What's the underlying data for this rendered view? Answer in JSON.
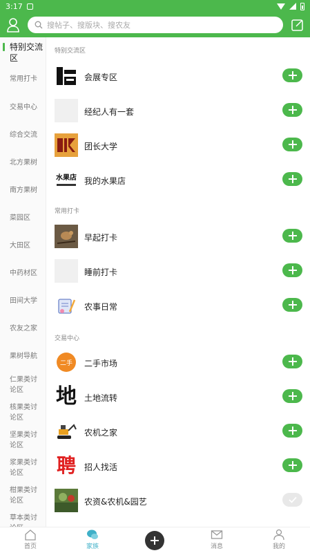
{
  "status": {
    "time": "3:17"
  },
  "search": {
    "placeholder": "搜帖子、搜版块、搜农友"
  },
  "sidebar": {
    "items": [
      {
        "label": "特别交流区",
        "active": true
      },
      {
        "label": "常用打卡"
      },
      {
        "label": "交易中心"
      },
      {
        "label": "综合交流"
      },
      {
        "label": "北方果树"
      },
      {
        "label": "南方果树"
      },
      {
        "label": "菜园区"
      },
      {
        "label": "大田区"
      },
      {
        "label": "中药材区"
      },
      {
        "label": "田间大学"
      },
      {
        "label": "农友之家"
      },
      {
        "label": "果树导航"
      },
      {
        "label": "仁果类讨论区"
      },
      {
        "label": "核果类讨论区"
      },
      {
        "label": "坚果类讨论区"
      },
      {
        "label": "浆果类讨论区"
      },
      {
        "label": "柑果类讨论区"
      },
      {
        "label": "草本类讨论区"
      }
    ]
  },
  "sections": [
    {
      "title": "特别交流区",
      "rows": [
        {
          "label": "会展专区",
          "icon": "exhibition-logo"
        },
        {
          "label": "经纪人有一套",
          "icon": "blank-placeholder"
        },
        {
          "label": "团长大学",
          "icon": "tuanzhang-logo"
        },
        {
          "label": "我的水果店",
          "icon": "fruit-shop-logo",
          "logo_text": "水果店"
        }
      ]
    },
    {
      "title": "常用打卡",
      "rows": [
        {
          "label": "早起打卡",
          "icon": "bird-photo"
        },
        {
          "label": "睡前打卡",
          "icon": "blank-placeholder"
        },
        {
          "label": "农事日常",
          "icon": "notebook-icon"
        }
      ]
    },
    {
      "title": "交易中心",
      "rows": [
        {
          "label": "二手市场",
          "icon": "secondhand-logo",
          "logo_text": "二手"
        },
        {
          "label": "土地流转",
          "icon": "land-character",
          "logo_text": "地"
        },
        {
          "label": "农机之家",
          "icon": "excavator-icon"
        },
        {
          "label": "招人找活",
          "icon": "hire-character",
          "logo_text": "聘"
        },
        {
          "label": "农资&农机&园艺",
          "icon": "garden-photo",
          "joined": true
        }
      ]
    }
  ],
  "bottom_nav": {
    "home": "首页",
    "family": "家族",
    "messages": "消息",
    "mine": "我的"
  },
  "colors": {
    "brand": "#4cb84c",
    "active_tab": "#3fb0c8"
  }
}
